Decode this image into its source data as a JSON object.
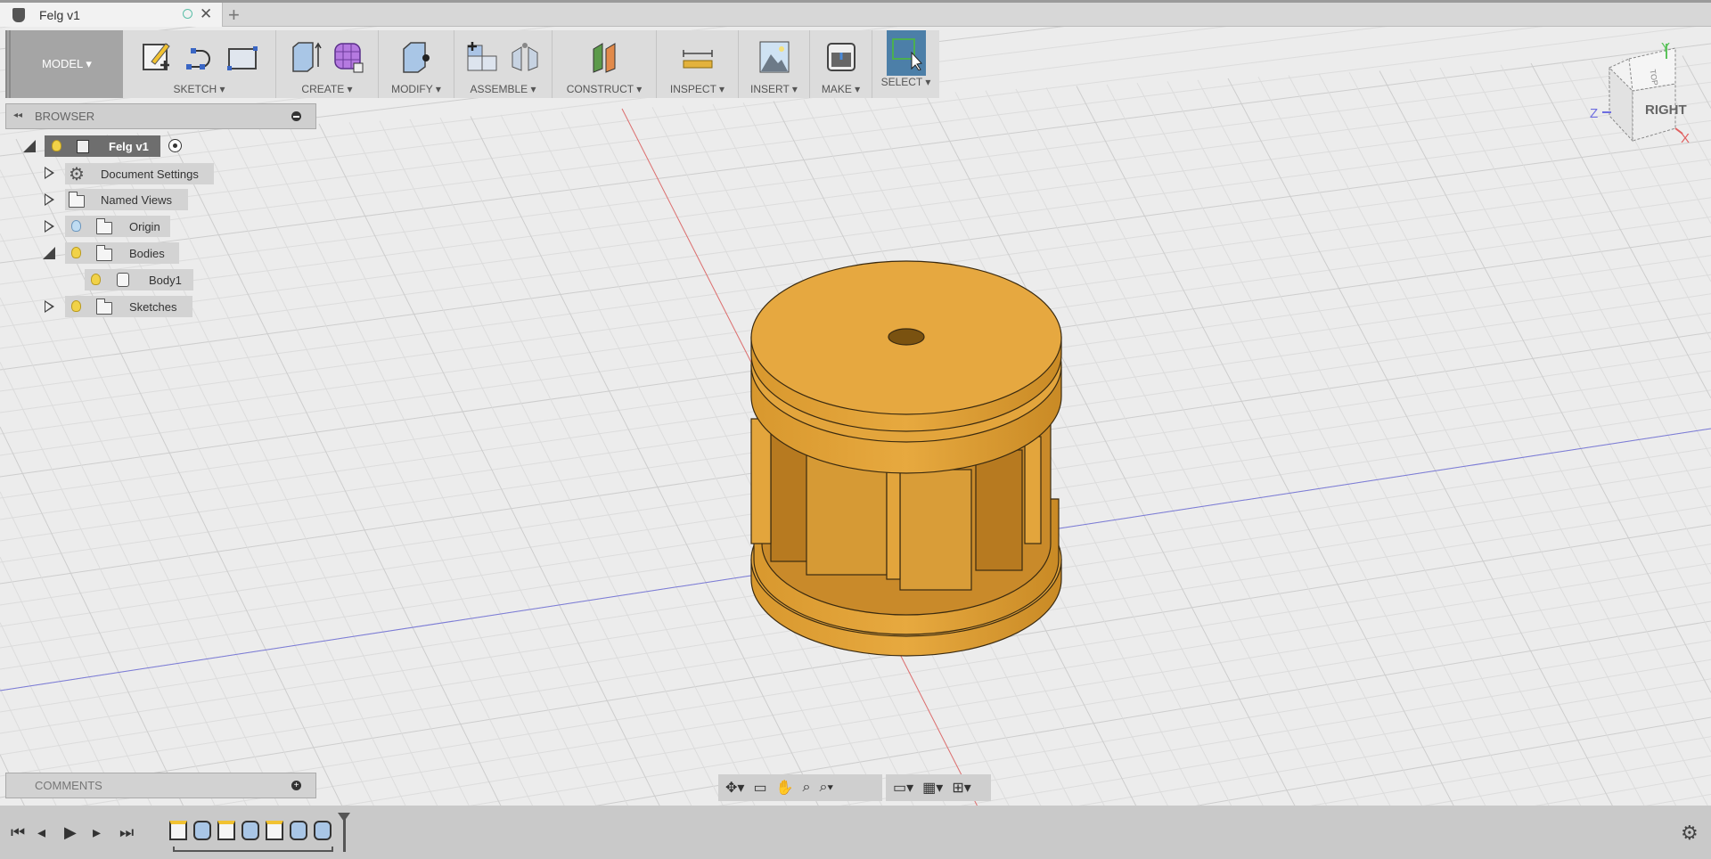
{
  "tab": {
    "title": "Felg v1",
    "new_tab": "+",
    "close": "✕"
  },
  "toolbar": {
    "workspace": "MODEL ▾",
    "groups": [
      {
        "label": "SKETCH ▾",
        "icons": [
          "create-sketch-icon",
          "line-arc-icon",
          "rectangle-icon"
        ]
      },
      {
        "label": "CREATE ▾",
        "icons": [
          "extrude-icon",
          "form-icon"
        ]
      },
      {
        "label": "MODIFY ▾",
        "icons": [
          "press-pull-icon"
        ]
      },
      {
        "label": "ASSEMBLE ▾",
        "icons": [
          "new-component-icon",
          "joint-icon"
        ]
      },
      {
        "label": "CONSTRUCT ▾",
        "icons": [
          "offset-plane-icon"
        ]
      },
      {
        "label": "INSPECT ▾",
        "icons": [
          "measure-icon"
        ]
      },
      {
        "label": "INSERT ▾",
        "icons": [
          "insert-image-icon"
        ]
      },
      {
        "label": "MAKE ▾",
        "icons": [
          "3d-print-icon"
        ]
      },
      {
        "label": "SELECT ▾",
        "icons": [
          "select-icon"
        ]
      }
    ]
  },
  "browser": {
    "title": "BROWSER",
    "collapse": "◂◂",
    "items": [
      {
        "label": "Felg v1"
      },
      {
        "label": "Document Settings"
      },
      {
        "label": "Named Views"
      },
      {
        "label": "Origin"
      },
      {
        "label": "Bodies"
      },
      {
        "label": "Body1"
      },
      {
        "label": "Sketches"
      }
    ]
  },
  "comments": {
    "title": "COMMENTS",
    "add": "+"
  },
  "viewcube": {
    "face": "RIGHT",
    "top": "TOP",
    "axes": {
      "x": "X",
      "y": "Y",
      "z": "Z"
    }
  },
  "colors": {
    "body": "#e3a53c",
    "x_axis": "#e07070",
    "z_axis": "#7a7ad8",
    "select_active": "#4c7fa8"
  },
  "navbar": [
    "orbit-icon",
    "look-at-icon",
    "pan-icon",
    "zoom-icon",
    "fit-icon",
    "display-settings-icon",
    "grid-settings-icon",
    "viewports-icon"
  ],
  "timeline": {
    "controls": [
      "first",
      "previous",
      "play",
      "next",
      "last"
    ],
    "features": [
      "sketch",
      "revolve",
      "sketch",
      "extrude",
      "sketch",
      "revolve",
      "pattern"
    ]
  }
}
